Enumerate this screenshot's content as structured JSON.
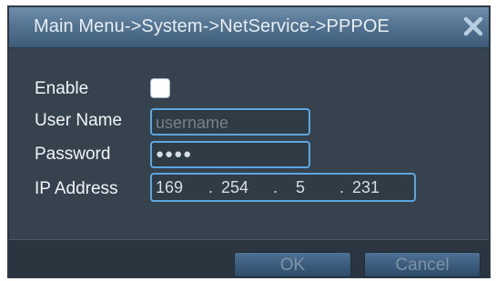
{
  "window": {
    "title": "Main Menu->System->NetService->PPPOE",
    "close_icon": "close-x-icon"
  },
  "form": {
    "enable": {
      "label": "Enable",
      "checked": false
    },
    "user_name": {
      "label": "User Name",
      "value": "",
      "placeholder": "username"
    },
    "password": {
      "label": "Password",
      "masked": "●●●●"
    },
    "ip_address": {
      "label": "IP Address",
      "octets": [
        "169",
        "254",
        "5",
        "231"
      ],
      "separator": "."
    }
  },
  "buttons": {
    "ok_label": "OK",
    "cancel_label": "Cancel"
  },
  "colors": {
    "title_bar": "#547491",
    "panel_bg": "#36434e",
    "field_border": "#5ea6df",
    "button": "#3b5b7c",
    "button_text": "#7f93a6"
  }
}
